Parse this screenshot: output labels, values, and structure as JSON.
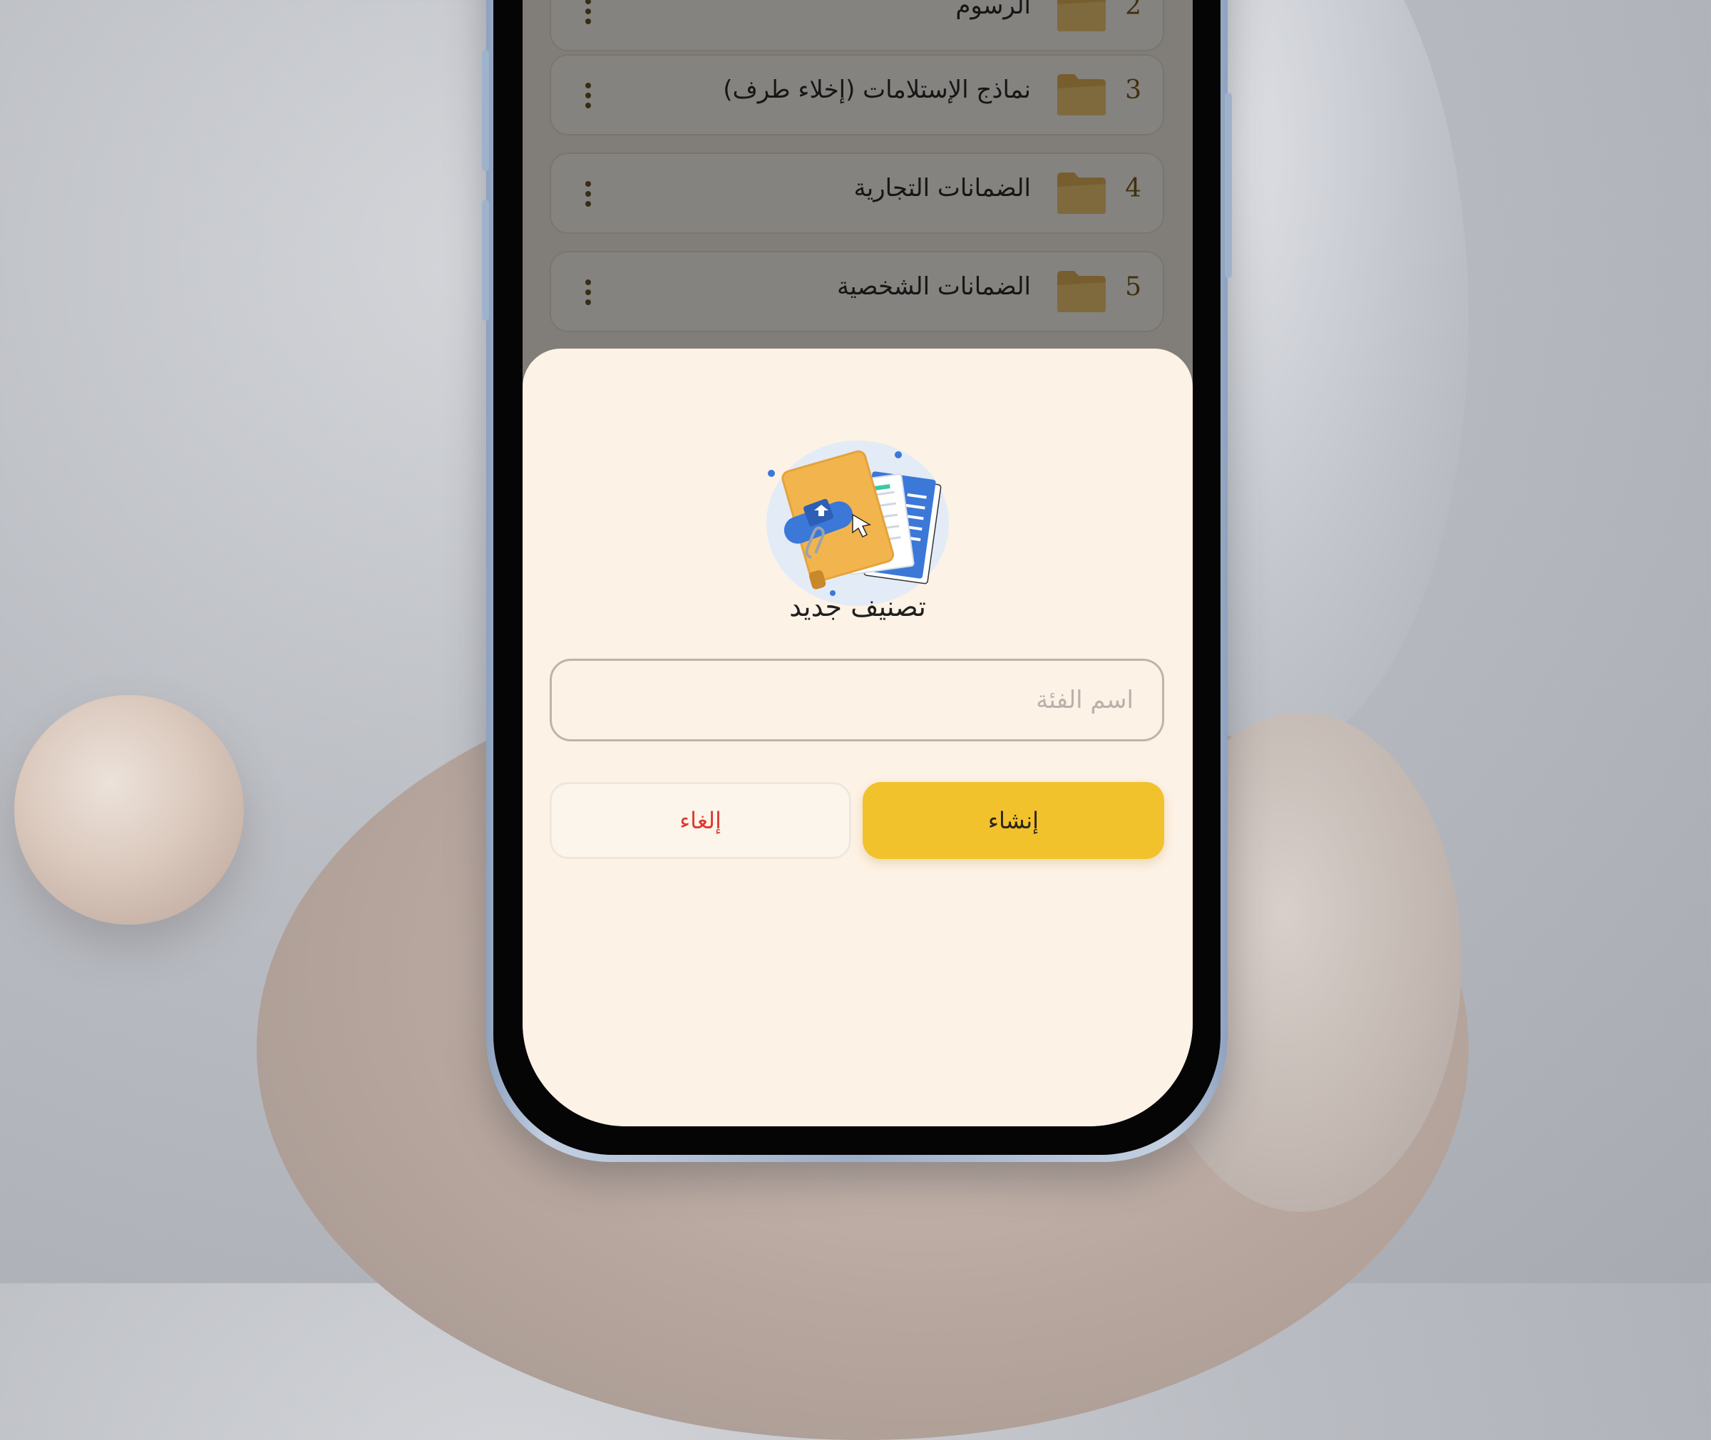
{
  "list": {
    "items": [
      {
        "number": "2",
        "label": "الرسوم"
      },
      {
        "number": "3",
        "label": "نماذج الإستلامات (إخلاء طرف)"
      },
      {
        "number": "4",
        "label": "الضمانات التجارية"
      },
      {
        "number": "5",
        "label": "الضمانات الشخصية"
      }
    ]
  },
  "dialog": {
    "title": "تصنيف جديد",
    "name_field": {
      "placeholder": "اسم الفئة",
      "value": ""
    },
    "create_label": "إنشاء",
    "cancel_label": "إلغاء"
  },
  "colors": {
    "accent": "#f2c22c",
    "cancel_text": "#e03a2f",
    "sheet_bg": "#fdf2e6",
    "folder": "#e0b25a"
  },
  "icons": [
    "folder-icon",
    "more-vertical-icon",
    "documents-folder-illustration"
  ]
}
